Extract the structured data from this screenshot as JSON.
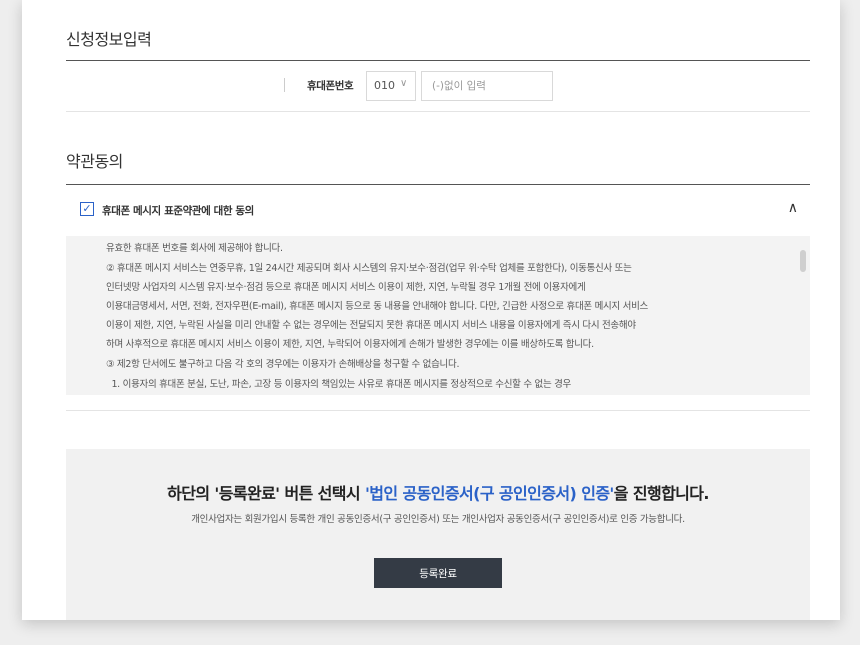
{
  "section1": {
    "title": "신청정보입력"
  },
  "phone": {
    "label": "휴대폰번호",
    "prefix": "010",
    "prefix_chevron": "∨",
    "placeholder": "(-)없이 입력"
  },
  "section2": {
    "title": "약관동의"
  },
  "agreement": {
    "checked": true,
    "check_glyph": "✓",
    "label": "휴대폰 메시지 표준약관에 대한 동의",
    "collapse_glyph": "∧",
    "accent_color": "#2b62c8"
  },
  "terms": {
    "lines": [
      "유효한 휴대폰 번호를 회사에 제공해야 합니다.",
      "② 휴대폰 메시지 서비스는 연중무휴, 1일 24시간 제공되며 회사 시스템의 유지·보수·점검(업무 위·수탁 업체를 포함한다), 이동통신사 또는",
      "인터넷망 사업자의 시스템 유지·보수·점검 등으로 휴대폰 메시지 서비스 이용이 제한, 지연, 누락될 경우 1개월 전에 이용자에게",
      "이용대금명세서, 서면, 전화, 전자우편(E-mail), 휴대폰 메시지 등으로 동 내용을 안내해야 합니다. 다만, 긴급한 사정으로 휴대폰 메시지 서비스",
      "이용이 제한, 지연, 누락된 사실을 미리 안내할 수 없는 경우에는 전달되지 못한 휴대폰 메시지 서비스 내용을 이용자에게 즉시 다시 전송해야",
      "하며 사후적으로 휴대폰 메시지 서비스 이용이 제한, 지연, 누락되어 이용자에게 손해가 발생한 경우에는 이를 배상하도록 합니다.",
      "③ 제2항 단서에도 불구하고 다음 각 호의 경우에는 이용자가 손해배상을 청구할 수 없습니다.",
      "  1. 이용자의 휴대폰 분실, 도난, 파손, 고장 등 이용자의 책임있는 사유로 휴대폰 메시지를 정상적으로 수신할 수 없는 경우"
    ]
  },
  "notice": {
    "head_prefix": "하단의 '등록완료' 버튼 선택시 ",
    "head_highlight": "'법인 공동인증서(구 공인인증서) 인증'",
    "head_suffix": "을 진행합니다.",
    "sub": "개인사업자는 회원가입시 등록한 개인 공동인증서(구 공인인증서) 또는 개인사업자 공동인증서(구 공인인증서)로 인증 가능합니다.",
    "submit_label": "등록완료"
  }
}
